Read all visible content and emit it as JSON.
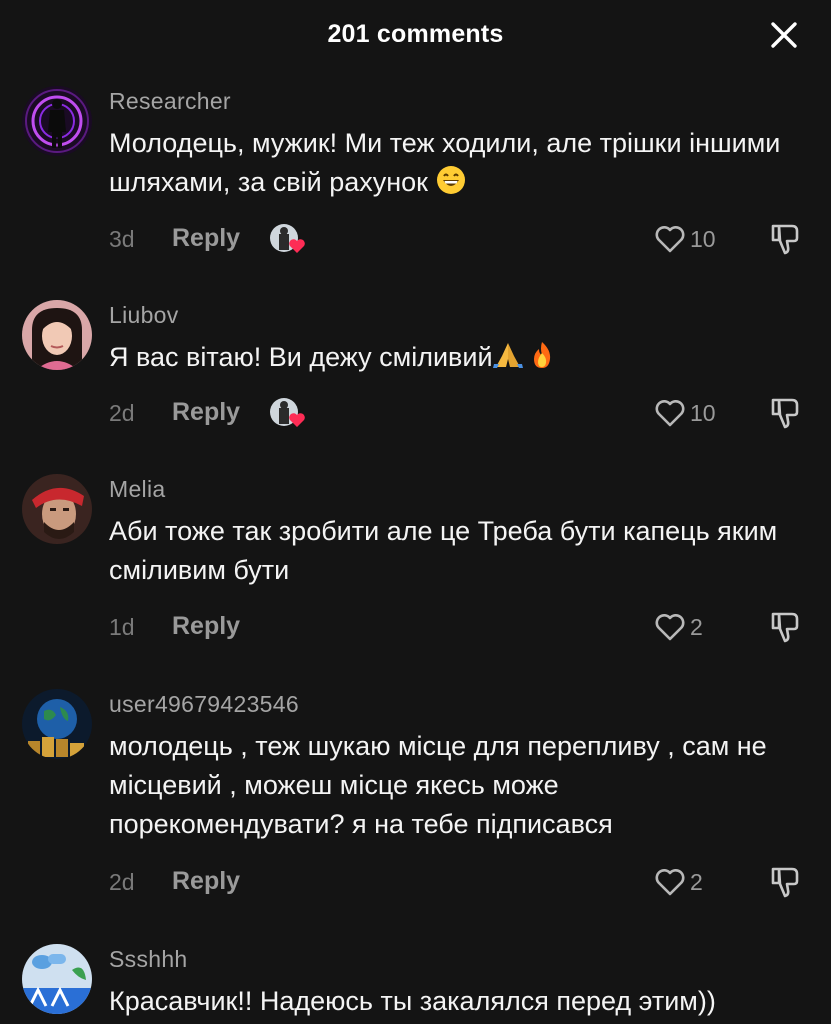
{
  "header": {
    "title": "201 comments"
  },
  "comments": [
    {
      "username": "Researcher",
      "text": "Молодець, мужик! Ми теж ходили, але трішки іншими шляхами, за свій рахунок",
      "time": "3d",
      "reply": "Reply",
      "likes": "10",
      "avatar_icon": "silhouette-neon-ring-avatar",
      "emoji": "grinning-face-emoji"
    },
    {
      "username": "Liubov",
      "text": "Я вас вітаю! Ви дежу сміливий",
      "time": "2d",
      "reply": "Reply",
      "likes": "10",
      "avatar_icon": "woman-portrait-avatar",
      "emoji": "praying-hands-and-fire-emoji"
    },
    {
      "username": "Melia",
      "text": "Аби тоже так зробити але це Треба бути капець яким сміливим бути",
      "time": "1d",
      "reply": "Reply",
      "likes": "2",
      "avatar_icon": "man-red-cap-avatar"
    },
    {
      "username": "user49679423546",
      "text": "молодець , теж шукаю місце для перепливу , сам не місцевий , можеш місце якесь може порекомендувати? я на тебе підписався",
      "time": "2d",
      "reply": "Reply",
      "likes": "2",
      "avatar_icon": "globe-coins-avatar"
    },
    {
      "username": "Ssshhh",
      "text": "Красавчик!! Надеюсь ты закалялся перед этим))",
      "avatar_icon": "cartoon-landscape-avatar"
    }
  ],
  "colors": {
    "background": "#141414",
    "text": "#f4f4f4",
    "muted": "#9a9a9a",
    "heart": "#fe2c55"
  }
}
